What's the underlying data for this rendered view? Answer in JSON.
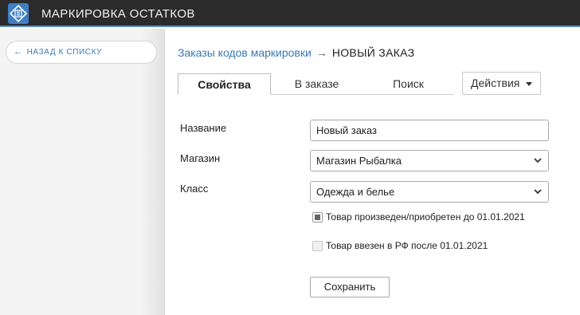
{
  "app": {
    "title": "МАРКИРОВКА ОСТАТКОВ",
    "logo_icon": "marking-logo-icon",
    "accent_color": "#3a78b5"
  },
  "sidebar": {
    "back_label": "НАЗАД К СПИСКУ",
    "back_icon": "arrow-left-icon"
  },
  "breadcrumb": {
    "parent": "Заказы кодов маркировки",
    "separator": "→",
    "current": "НОВЫЙ ЗАКАЗ"
  },
  "tabs": [
    {
      "label": "Свойства",
      "active": true
    },
    {
      "label": "В заказе",
      "active": false
    },
    {
      "label": "Поиск",
      "active": false
    }
  ],
  "actions": {
    "label": "Действия",
    "icon": "caret-down-icon"
  },
  "form": {
    "name_label": "Название",
    "name_value": "Новый заказ",
    "store_label": "Магазин",
    "store_value": "Магазин Рыбалка",
    "class_label": "Класс",
    "class_value": "Одежда и белье",
    "checkbox1_label": "Товар произведен/приобретен до 01.01.2021",
    "checkbox1_state": "indeterminate",
    "checkbox2_label": "Товар ввезен в РФ после 01.01.2021",
    "checkbox2_state": "unchecked-disabled",
    "save_label": "Сохранить"
  }
}
